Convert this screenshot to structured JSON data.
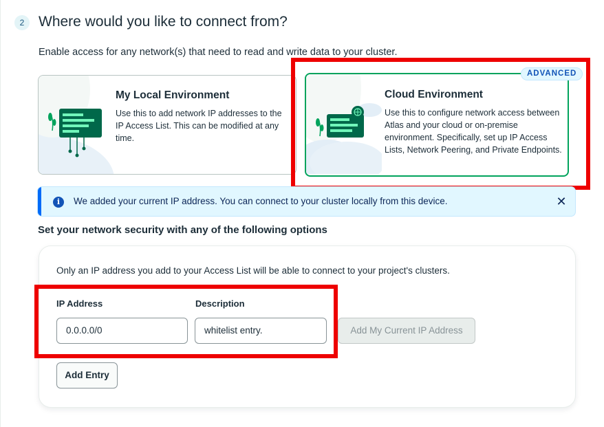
{
  "step": {
    "number": "2",
    "title": "Where would you like to connect from?",
    "subtitle": "Enable access for any network(s) that need to read and write data to your cluster."
  },
  "environments": {
    "local": {
      "title": "My Local Environment",
      "description": "Use this to add network IP addresses to the IP Access List. This can be modified at any time.",
      "selected": false
    },
    "cloud": {
      "title": "Cloud Environment",
      "description": "Use this to configure network access between Atlas and your cloud or on-premise environment. Specifically, set up IP Access Lists, Network Peering, and Private Endpoints.",
      "badge": "ADVANCED",
      "selected": true
    }
  },
  "banner": {
    "text": "We added your current IP address. You can connect to your cluster locally from this device.",
    "icon": "info-icon",
    "close_icon": "close-icon"
  },
  "security": {
    "section_title": "Set your network security with any of the following options",
    "description": "Only an IP address you add to your Access List will be able to connect to your project's clusters.",
    "ip_label": "IP Address",
    "ip_value": "0.0.0.0/0",
    "desc_label": "Description",
    "desc_value": "whitelist entry.",
    "current_ip_button": "Add My Current IP Address",
    "add_entry_button": "Add Entry"
  },
  "colors": {
    "accent_green": "#00a35c",
    "highlight_red": "#ee0000",
    "info_blue": "#016bf8",
    "banner_bg": "#e1f7ff"
  }
}
